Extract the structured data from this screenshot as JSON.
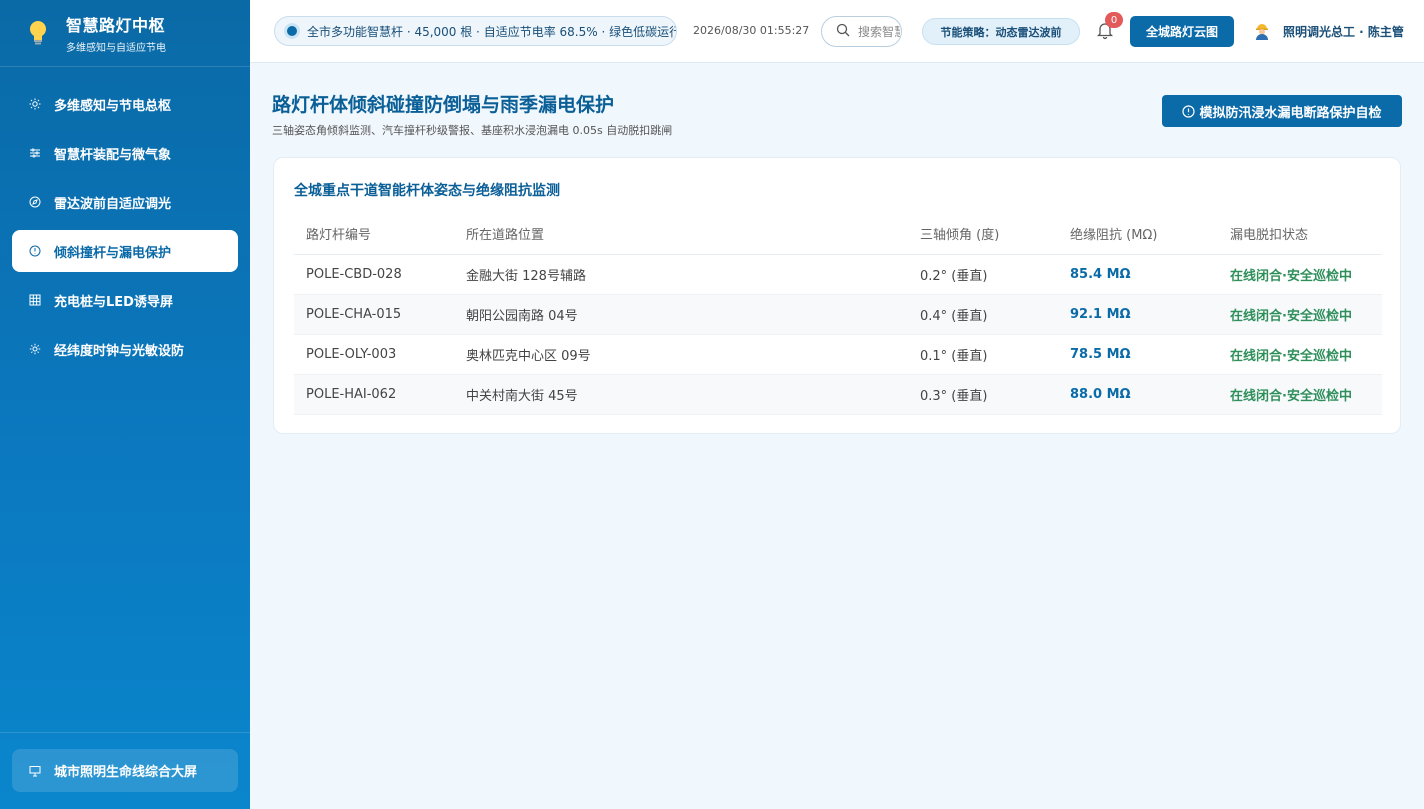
{
  "brand": {
    "title": "智慧路灯中枢",
    "subtitle": "多维感知与自适应节电"
  },
  "sidebar": {
    "items": [
      {
        "label": "多维感知与节电总枢",
        "icon": "sun-icon"
      },
      {
        "label": "智慧杆装配与微气象",
        "icon": "sliders-icon"
      },
      {
        "label": "雷达波前自适应调光",
        "icon": "compass-icon"
      },
      {
        "label": "倾斜撞杆与漏电保护",
        "icon": "alert-circle-icon"
      },
      {
        "label": "充电桩与LED诱导屏",
        "icon": "grid-icon"
      },
      {
        "label": "经纬度时钟与光敏设防",
        "icon": "gear-icon"
      }
    ],
    "active_index": 3,
    "footer": {
      "label": "城市照明生命线综合大屏",
      "icon": "presentation-icon"
    }
  },
  "topbar": {
    "status": "全市多功能智慧杆 · 45,000 根 · 自适应节电率 68.5% · 绿色低碳运行",
    "datetime": "2026/08/30 01:55:27",
    "search_placeholder": "搜索智慧杆",
    "strategy": "节能策略：动态雷达波前",
    "notification_count": "0",
    "cloud_button": "全城路灯云图",
    "user": "照明调光总工 · 陈主管"
  },
  "page": {
    "title": "路灯杆体倾斜碰撞防倒塌与雨季漏电保护",
    "subtitle": "三轴姿态角倾斜监测、汽车撞杆秒级警报、基座积水浸泡漏电 0.05s 自动脱扣跳闸",
    "selfcheck_button": "模拟防汛浸水漏电断路保护自检"
  },
  "card": {
    "title": "全城重点干道智能杆体姿态与绝缘阻抗监测",
    "columns": [
      "路灯杆编号",
      "所在道路位置",
      "三轴倾角 (度)",
      "绝缘阻抗 (MΩ)",
      "漏电脱扣状态"
    ],
    "rows": [
      {
        "id": "POLE-CBD-028",
        "location": "金融大街 128号辅路",
        "tilt": "0.2° (垂直)",
        "resistance": "85.4 MΩ",
        "status": "在线闭合·安全巡检中"
      },
      {
        "id": "POLE-CHA-015",
        "location": "朝阳公园南路 04号",
        "tilt": "0.4° (垂直)",
        "resistance": "92.1 MΩ",
        "status": "在线闭合·安全巡检中"
      },
      {
        "id": "POLE-OLY-003",
        "location": "奥林匹克中心区 09号",
        "tilt": "0.1° (垂直)",
        "resistance": "78.5 MΩ",
        "status": "在线闭合·安全巡检中"
      },
      {
        "id": "POLE-HAI-062",
        "location": "中关村南大街 45号",
        "tilt": "0.3° (垂直)",
        "resistance": "88.0 MΩ",
        "status": "在线闭合·安全巡检中"
      }
    ]
  },
  "colors": {
    "primary": "#0b6aa8",
    "ok_green": "#2f8f5b",
    "badge_red": "#e35a5a"
  }
}
